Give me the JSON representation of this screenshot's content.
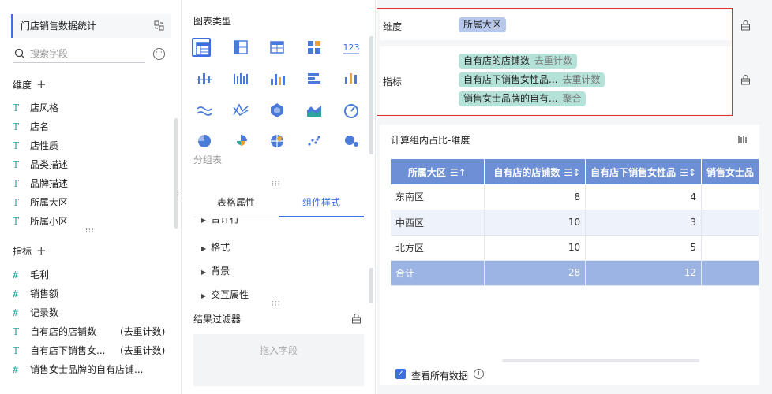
{
  "left_panel": {
    "title": "门店销售数据统计",
    "search_placeholder": "搜索字段",
    "dimension_header": "维度",
    "dimensions": [
      "店风格",
      "店名",
      "店性质",
      "品类描述",
      "品牌描述",
      "所属大区",
      "所属小区"
    ],
    "measure_header": "指标",
    "measures": [
      {
        "icon": "#",
        "name": "毛利",
        "agg": ""
      },
      {
        "icon": "#",
        "name": "销售额",
        "agg": ""
      },
      {
        "icon": "#",
        "name": "记录数",
        "agg": ""
      },
      {
        "icon": "T",
        "name": "自有店的店铺数",
        "agg": "(去重计数)"
      },
      {
        "icon": "T",
        "name": "自有店下销售女...",
        "agg": "(去重计数)"
      },
      {
        "icon": "#",
        "name": "销售女士品牌的自有店铺...",
        "agg": ""
      }
    ]
  },
  "middle_panel": {
    "chart_type_title": "图表类型",
    "group_table_label": "分组表",
    "tabs": [
      "表格属性",
      "组件样式"
    ],
    "properties": [
      "合计行",
      "格式",
      "背景",
      "交互属性"
    ],
    "filter_title": "结果过滤器",
    "drop_placeholder": "拖入字段"
  },
  "config": {
    "dimension_label": "维度",
    "dimension_chip": "所属大区",
    "indicator_label": "指标",
    "indicators": [
      {
        "name": "自有店的店铺数",
        "agg": "去重计数"
      },
      {
        "name": "自有店下销售女性品...",
        "agg": "去重计数"
      },
      {
        "name": "销售女士品牌的自有...",
        "agg": "聚合"
      }
    ]
  },
  "table_widget": {
    "title": "计算组内占比-维度",
    "headers": [
      "所属大区",
      "自有店的店铺数",
      "自有店下销售女性品",
      "销售女士品"
    ],
    "rows": [
      [
        "东南区",
        "8",
        "4",
        ""
      ],
      [
        "中西区",
        "10",
        "3",
        ""
      ],
      [
        "北方区",
        "10",
        "5",
        ""
      ]
    ],
    "total": [
      "合计",
      "28",
      "12",
      ""
    ],
    "checkbox_label": "查看所有数据"
  },
  "colors": {
    "accent": "#3d6fe0",
    "header_bg": "#6d8fd6",
    "total_bg": "#9bb4e3",
    "dim_chip": "#b6c8ec",
    "ind_chip": "#b4e1d8",
    "highlight_border": "#e0302f"
  }
}
